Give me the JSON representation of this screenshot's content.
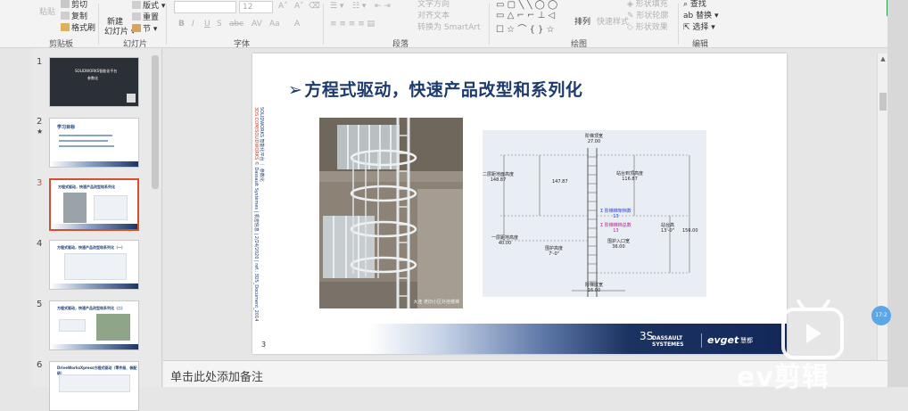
{
  "ribbon": {
    "clipboard": {
      "paste_label": "粘贴",
      "cut_label": "剪切",
      "copy_label": "复制",
      "format_painter_label": "格式刷",
      "group_label": "剪贴板"
    },
    "slides": {
      "new_slide_label": "新建",
      "new_slide_label2": "幻灯片",
      "layout_label": "版式",
      "reset_label": "重置",
      "section_label": "节",
      "group_label": "幻灯片"
    },
    "font": {
      "size_value": "12",
      "group_label": "字体",
      "buttons": [
        "B",
        "I",
        "U",
        "S",
        "abc",
        "AV",
        "Aa",
        "A"
      ]
    },
    "paragraph": {
      "text_direction_label": "文字方向",
      "align_text_label": "对齐文本",
      "smartart_label": "转换为 SmartArt",
      "group_label": "段落"
    },
    "drawing": {
      "arrange_label": "排列",
      "quick_styles_label": "快速样式",
      "shape_fill_label": "形状填充",
      "shape_outline_label": "形状轮廓",
      "shape_effects_label": "形状效果",
      "group_label": "绘图"
    },
    "editing": {
      "find_label": "查找",
      "replace_label": "替换",
      "select_label": "选择",
      "group_label": "编辑"
    }
  },
  "thumbnails": [
    {
      "number": "1",
      "title": "SOLIDWORKS智能化平台",
      "subtitle": "参数化"
    },
    {
      "number": "2",
      "title": "学习目标",
      "starred": true
    },
    {
      "number": "3",
      "title": "方程式驱动，快速产品改型和系列化",
      "selected": true
    },
    {
      "number": "4",
      "title": "方程式驱动，快速产品改型和系列化（一）"
    },
    {
      "number": "5",
      "title": "方程式驱动，快速产品改型和系列化（二）"
    },
    {
      "number": "6",
      "title": "DriveWorksXpress方程式驱动（零件级、装配级）"
    }
  ],
  "slide": {
    "title_arrow": "➢",
    "title": "方程式驱动，快速产品改型和系列化",
    "side_text_1": "SOLIDWORKS 智能化平台 ｜ 参数化",
    "side_text_2_red": "3DS.COM/SOLIDWORKS",
    "side_text_2_blue": " © Dassault Systèmes | 机密信息 | 2/24/2020 | ref.: 3DS_Document_2014",
    "photo_watermark": "大连 老旧小区外挂楼梯",
    "slide_number": "3",
    "brand_line1": "DASSAULT",
    "brand_line2": "SYSTEMES",
    "brand_ds": "3S",
    "brand_evget": "evget",
    "brand_cn": "慧都",
    "diagram": {
      "top_width_label": "阶梯顶宽",
      "top_width_value": "27.00",
      "second_floor_height_label": "二层距地面高度",
      "second_floor_height_value": "148.87",
      "dim_value_147": "147.87",
      "platform_height_label": "站台到顶高度",
      "platform_height_value": "116.87",
      "rungs_per_ladder_label": "Σ 阶梯梯架档数",
      "rungs_per_ladder_value": "13",
      "rungs_total_label": "Σ 阶梯梯档总数",
      "rungs_total_value": "13",
      "platform_label": "站台高",
      "platform_value": "13'-0\"",
      "right_value": "156.00",
      "opening_label": "一层距地高度",
      "opening_value": "40.00",
      "cage_height_label": "围护高度",
      "cage_height_value": "7'-0\"",
      "entry_width_label": "围护入口宽",
      "entry_width_value": "36.00",
      "bottom_width_label": "阶梯底宽",
      "bottom_width_value": "16.00"
    }
  },
  "notes": {
    "placeholder": "单击此处添加备注"
  },
  "overlay": {
    "badge_text": "17:2",
    "brand_text": "ev剪辑"
  }
}
